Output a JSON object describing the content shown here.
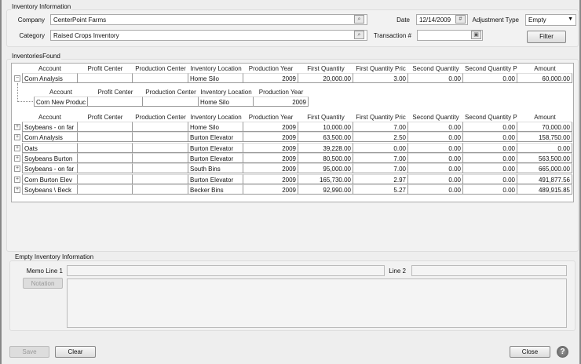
{
  "inventory_info": {
    "title": "Inventory Information",
    "company_label": "Company",
    "company_value": "CenterPoint Farms",
    "category_label": "Category",
    "category_value": "Raised Crops Inventory",
    "date_label": "Date",
    "date_value": "12/14/2009",
    "adjustment_type_label": "Adjustment Type",
    "adjustment_type_value": "Empty",
    "transaction_label": "Transaction #",
    "transaction_value": "",
    "filter_label": "Filter"
  },
  "inventories_found": {
    "title": "InventoriesFound",
    "columns": [
      "Account",
      "Profit Center",
      "Production Center",
      "Inventory Location",
      "Production Year",
      "First Quantity",
      "First Quantity Pric",
      "Second Quantity",
      "Second Quantity P",
      "Amount"
    ],
    "expanded_row": [
      "Corn Analysis",
      "",
      "",
      "Home Silo",
      "2009",
      "20,000.00",
      "3.00",
      "0.00",
      "0.00",
      "60,000.00"
    ],
    "child_columns": [
      "Account",
      "Profit Center",
      "Production Center",
      "Inventory Location",
      "Production Year"
    ],
    "child_row": [
      "Corn New Produc",
      "",
      "",
      "Home Silo",
      "2009"
    ],
    "rows": [
      [
        "Soybeans - on far",
        "",
        "",
        "Home Silo",
        "2009",
        "10,000.00",
        "7.00",
        "0.00",
        "0.00",
        "70,000.00"
      ],
      [
        "Corn Analysis",
        "",
        "",
        "Burton Elevator",
        "2009",
        "63,500.00",
        "2.50",
        "0.00",
        "0.00",
        "158,750.00"
      ],
      [
        "Oats",
        "",
        "",
        "Burton Elevator",
        "2009",
        "39,228.00",
        "0.00",
        "0.00",
        "0.00",
        "0.00"
      ],
      [
        "Soybeans Burton",
        "",
        "",
        "Burton Elevator",
        "2009",
        "80,500.00",
        "7.00",
        "0.00",
        "0.00",
        "563,500.00"
      ],
      [
        "Soybeans - on far",
        "",
        "",
        "South Bins",
        "2009",
        "95,000.00",
        "7.00",
        "0.00",
        "0.00",
        "665,000.00"
      ],
      [
        "Corn Burton Elev",
        "",
        "",
        "Burton Elevator",
        "2009",
        "165,730.00",
        "2.97",
        "0.00",
        "0.00",
        "491,877.56"
      ],
      [
        "Soybeans \\ Beck",
        "",
        "",
        "Becker Bins",
        "2009",
        "92,990.00",
        "5.27",
        "0.00",
        "0.00",
        "489,915.85"
      ]
    ]
  },
  "empty_info": {
    "title": "Empty Inventory Information",
    "memo1_label": "Memo Line 1",
    "memo1_value": "",
    "line2_label": "Line 2",
    "line2_value": "",
    "notation_label": "Notation",
    "notation_value": ""
  },
  "footer": {
    "save_label": "Save",
    "clear_label": "Clear",
    "close_label": "Close",
    "help_icon": "?"
  }
}
